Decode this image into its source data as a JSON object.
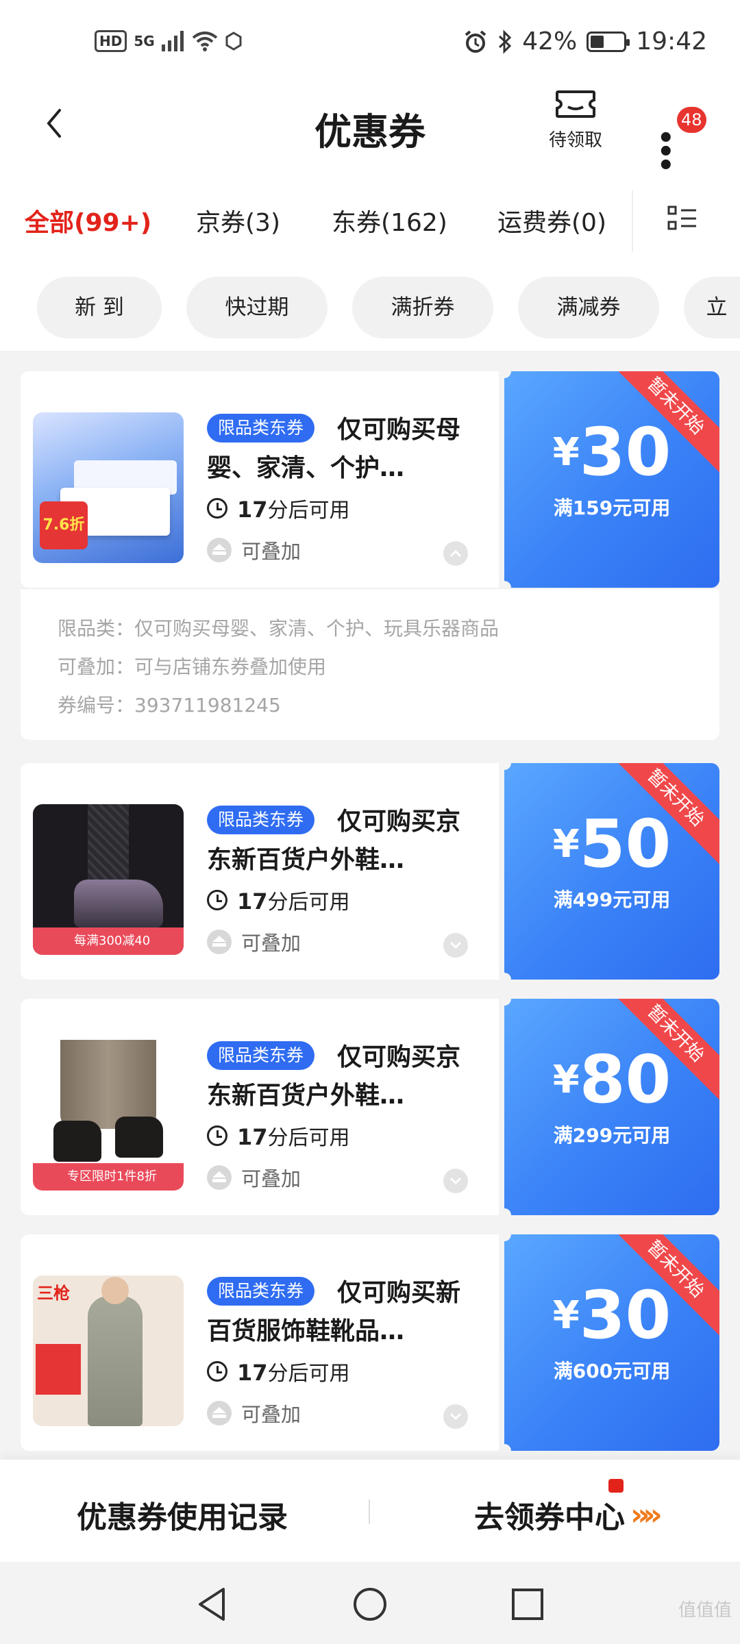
{
  "status_bar": {
    "left_icons": [
      "HD",
      "5G",
      "signal-icon",
      "wifi-icon",
      "nfc-icon"
    ],
    "hd": "HD",
    "network": "5G",
    "battery": "42%",
    "battery_level": 0.42,
    "time": "19:42"
  },
  "header": {
    "title": "优惠券",
    "pending_label": "待领取",
    "badge_count": "48"
  },
  "tabs": [
    {
      "label": "全部(99+)",
      "active": true
    },
    {
      "label": "京券(3)",
      "active": false
    },
    {
      "label": "东券(162)",
      "active": false
    },
    {
      "label": "运费券(0)",
      "active": false
    }
  ],
  "filters": [
    "新 到",
    "快过期",
    "满折券",
    "满减券",
    "立"
  ],
  "coupons": [
    {
      "tag": "限品类东券",
      "title": "仅可购买母婴、家清、个护…",
      "time_num": "17",
      "time_text": "分后可用",
      "stack": "可叠加",
      "yen": "¥",
      "amount": "30",
      "condition": "满159元可用",
      "ribbon": "暂未开始",
      "thumb_text": "7.6折",
      "details": [
        "限品类：仅可购买母婴、家清、个护、玩具乐器商品",
        "可叠加：可与店铺东券叠加使用",
        "券编号：393711981245"
      ]
    },
    {
      "tag": "限品类东券",
      "title": "仅可购买京东新百货户外鞋…",
      "time_num": "17",
      "time_text": "分后可用",
      "stack": "可叠加",
      "yen": "¥",
      "amount": "50",
      "condition": "满499元可用",
      "ribbon": "暂未开始",
      "thumb_text": "每满300减40"
    },
    {
      "tag": "限品类东券",
      "title": "仅可购买京东新百货户外鞋…",
      "time_num": "17",
      "time_text": "分后可用",
      "stack": "可叠加",
      "yen": "¥",
      "amount": "80",
      "condition": "满299元可用",
      "ribbon": "暂未开始",
      "thumb_text": "专区限时1件8折"
    },
    {
      "tag": "限品类东券",
      "title": "仅可购买新百货服饰鞋靴品…",
      "time_num": "17",
      "time_text": "分后可用",
      "stack": "可叠加",
      "yen": "¥",
      "amount": "30",
      "condition": "满600元可用",
      "ribbon": "暂未开始",
      "thumb_text": "三枪"
    }
  ],
  "bottom": {
    "history": "优惠券使用记录",
    "center": "去领券中心",
    "arrows": "»»"
  },
  "watermark": "值值值"
}
